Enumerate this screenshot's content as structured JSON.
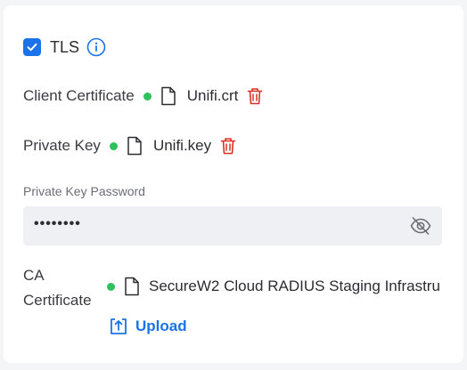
{
  "tls": {
    "label": "TLS",
    "checked": true
  },
  "client_certificate": {
    "label": "Client Certificate",
    "file": "Unifi.crt"
  },
  "private_key": {
    "label": "Private Key",
    "file": "Unifi.key"
  },
  "private_key_password": {
    "label": "Private Key Password",
    "value": "••••••••"
  },
  "ca_certificate": {
    "label_line1": "CA",
    "label_line2": "Certificate",
    "file": "SecureW2 Cloud RADIUS Staging Infrastru",
    "upload_label": "Upload"
  },
  "colors": {
    "accent": "#1a73e8",
    "status_ok": "#2ec15b",
    "delete": "#d93025"
  },
  "icons": [
    "checkmark-icon",
    "info-icon",
    "file-icon",
    "trash-icon",
    "eye-off-icon",
    "upload-icon"
  ]
}
